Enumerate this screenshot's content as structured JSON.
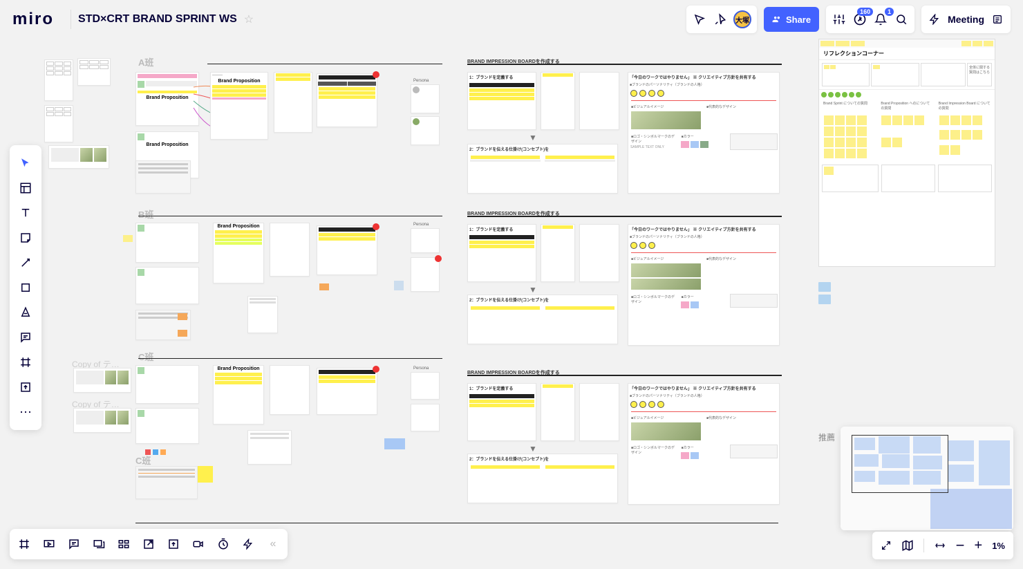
{
  "app": {
    "logo": "miro",
    "board_title": "STD×CRT BRAND SPRINT WS"
  },
  "topright": {
    "share_label": "Share",
    "activity_count": "160",
    "notif_count": "1",
    "meeting_label": "Meeting",
    "avatar_initials": "大塚"
  },
  "zoom": {
    "pct": "1%"
  },
  "sections": {
    "a": "A班",
    "b": "B班",
    "c": "C班",
    "c2": "C班",
    "copy1": "Copy of テ…",
    "copy2": "Copy of テ…",
    "copy3": "Copy of",
    "brand_impression": "BRAND IMPRESSION BOARDを作成する",
    "brand_prop": "Brand Proposition",
    "persona": "Persona",
    "reflection": "リフレクションコーナー",
    "bi_step1": "1：ブランドを定義する",
    "bi_step2": "2：ブランドを伝える仕掛け(コンセプト)を",
    "bi_visual": "■ビジュアルイメージ",
    "bi_design": "■代表的なデザイン",
    "bi_logo": "■ロゴ・シンボルマークのデザイン",
    "bi_color": "■カラー",
    "bi_personality": "■ブランドのパーソナリティ（ブランドの人格）",
    "bi_today": "「今日のワークではやりません」 ※ クリエイティブ方針を共有する",
    "sample": "SAMPLE TEXT ONLY",
    "brandsprint_q": "Brand Sprint\nについての質問",
    "brandprop_q": "Brand Proposition\nへのについての質問",
    "brandimpr_q": "Brand Impression Board\nについての質問",
    "general_q": "全体に関する\n質問はこちら",
    "recommend": "推薦"
  },
  "colors": {
    "yellow": "#fff04d",
    "sticky": "#fdf08a",
    "blue": "#4262ff",
    "green": "#7ac142",
    "pink": "#f5a8c8",
    "orange": "#f5a85a"
  }
}
